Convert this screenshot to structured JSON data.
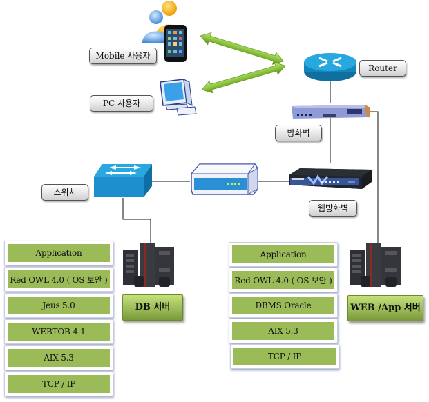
{
  "diagram": {
    "title": "",
    "nodes": {
      "mobile_user": {
        "label": "Mobile 사용자",
        "icon": "mobile-users-icon"
      },
      "pc_user": {
        "label": "PC 사용자",
        "icon": "desktop-pc-icon"
      },
      "router": {
        "label": "Router",
        "icon": "router-icon"
      },
      "firewall": {
        "label": "방화벽",
        "icon": "firewall-appliance-icon"
      },
      "switch": {
        "label": "스위치",
        "icon": "network-switch-icon"
      },
      "hub": {
        "label": "",
        "icon": "network-device-icon"
      },
      "web_firewall": {
        "label": "웹방화벽",
        "icon": "web-firewall-appliance-icon"
      },
      "db_server": {
        "label": "DB 서버",
        "icon": "server-rack-icon"
      },
      "web_app_server": {
        "label": "WEB /App 서버",
        "icon": "server-rack-icon"
      }
    },
    "db_stack": [
      "Application",
      "Red OWL 4.0 ( OS 보안 )",
      "Jeus 5.0",
      "WEBTOB  4.1",
      "AIX  5.3",
      "TCP  / IP"
    ],
    "web_stack": [
      "Application",
      "Red OWL 4.0 ( OS 보안 )",
      "DBMS  Oracle",
      "AIX  5.3",
      "TCP  / IP"
    ],
    "edges": [
      [
        "mobile_user",
        "router"
      ],
      [
        "pc_user",
        "router"
      ],
      [
        "router",
        "firewall"
      ],
      [
        "firewall",
        "web_firewall"
      ],
      [
        "firewall",
        "web_app_server"
      ],
      [
        "web_firewall",
        "hub"
      ],
      [
        "hub",
        "switch"
      ],
      [
        "switch",
        "db_server"
      ]
    ],
    "colors": {
      "layer_fill": "#9bbb59",
      "arrow_green": "#8cc63f",
      "switch_blue": "#1e9ad6",
      "router_blue": "#1aa0d8"
    }
  }
}
